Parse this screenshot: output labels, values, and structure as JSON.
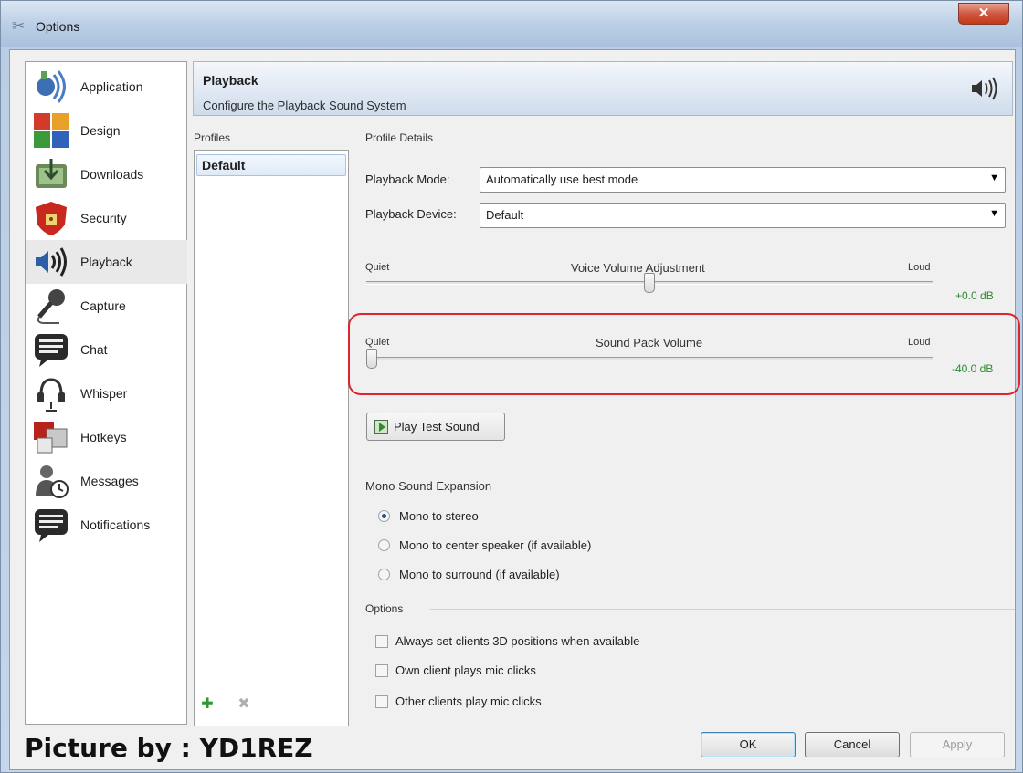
{
  "window": {
    "title": "Options",
    "close_label": "✕"
  },
  "sidebar": {
    "items": [
      {
        "label": "Application",
        "icon": "application-icon"
      },
      {
        "label": "Design",
        "icon": "design-icon"
      },
      {
        "label": "Downloads",
        "icon": "downloads-icon"
      },
      {
        "label": "Security",
        "icon": "security-icon"
      },
      {
        "label": "Playback",
        "icon": "playback-icon",
        "active": true
      },
      {
        "label": "Capture",
        "icon": "microphone-icon"
      },
      {
        "label": "Chat",
        "icon": "chat-icon"
      },
      {
        "label": "Whisper",
        "icon": "whisper-icon"
      },
      {
        "label": "Hotkeys",
        "icon": "hotkeys-icon"
      },
      {
        "label": "Messages",
        "icon": "messages-icon"
      },
      {
        "label": "Notifications",
        "icon": "notifications-icon"
      }
    ]
  },
  "header": {
    "title": "Playback",
    "subtitle": "Configure the Playback Sound System",
    "icon": "speaker-icon"
  },
  "profiles": {
    "label": "Profiles",
    "items": [
      "Default"
    ]
  },
  "details": {
    "label": "Profile Details",
    "playback_mode": {
      "label": "Playback Mode:",
      "value": "Automatically use best mode"
    },
    "playback_device": {
      "label": "Playback Device:",
      "value": "Default"
    },
    "voice_volume": {
      "title": "Voice Volume Adjustment",
      "min_label": "Quiet",
      "max_label": "Loud",
      "value": "+0.0 dB",
      "level": 0.5
    },
    "sound_pack_volume": {
      "title": "Sound Pack Volume",
      "min_label": "Quiet",
      "max_label": "Loud",
      "value": "-40.0 dB",
      "level": 0.0
    },
    "play_test_label": "Play Test Sound",
    "mono": {
      "title": "Mono Sound Expansion",
      "options": [
        "Mono to stereo",
        "Mono to center speaker (if available)",
        "Mono to surround (if available)"
      ],
      "selected": 0
    },
    "options": {
      "title": "Options",
      "checks": [
        "Always set clients 3D positions when available",
        "Own client plays mic clicks",
        "Other clients play mic clicks"
      ]
    }
  },
  "buttons": {
    "ok": "OK",
    "cancel": "Cancel",
    "apply": "Apply"
  },
  "watermark": "Picture by : YD1REZ",
  "colors": {
    "accent": "#2e8b2e",
    "highlight": "#e0242c"
  }
}
